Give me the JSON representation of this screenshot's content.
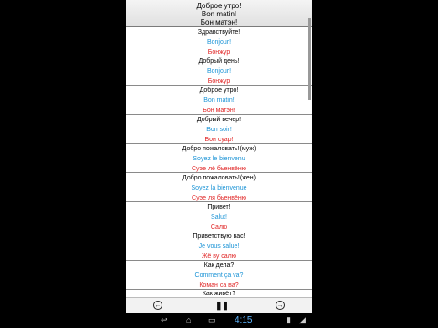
{
  "header": {
    "line1": "Доброе утро!",
    "line2": "Bon matin!",
    "line3": "Бон матэн!"
  },
  "phrases": [
    {
      "ru": "Здравствуйте!",
      "fr": "Bonjour!",
      "tr": "Бонжур"
    },
    {
      "ru": "Добрый день!",
      "fr": "Bonjour!",
      "tr": "Бонжур"
    },
    {
      "ru": "Доброе утро!",
      "fr": "Bon matin!",
      "tr": "Бон матэн!"
    },
    {
      "ru": "Добрый вечер!",
      "fr": "Bon soir!",
      "tr": "Бон суар!"
    },
    {
      "ru": "Добро пожаловать!(муж)",
      "fr": "Soyez le bienvenu",
      "tr": "Суэе лё бьенвёню"
    },
    {
      "ru": "Добро пожаловать!(жен)",
      "fr": "Soyez la bienvenue",
      "tr": "Суэе ля бьенвёню"
    },
    {
      "ru": "Привет!",
      "fr": "Salut!",
      "tr": "Салю"
    },
    {
      "ru": "Приветствую вас!",
      "fr": "Je vous salue!",
      "tr": "Жё ву салю"
    },
    {
      "ru": "Как дела?",
      "fr": "Comment ça va?",
      "tr": "Коман са ва?"
    }
  ],
  "partial_row": "Как живёт?",
  "controls": {
    "prev_icon": "left-arrow-icon",
    "pause_icon": "pause-icon",
    "next_icon": "right-arrow-icon",
    "pause_glyph": "❚❚",
    "prev_glyph": "←",
    "next_glyph": "→"
  },
  "system": {
    "time": "4:15",
    "back_icon": "back-icon",
    "home_icon": "home-icon",
    "recent_icon": "recent-apps-icon"
  },
  "colors": {
    "french": "#1a93d6",
    "transcription": "#e02424"
  }
}
